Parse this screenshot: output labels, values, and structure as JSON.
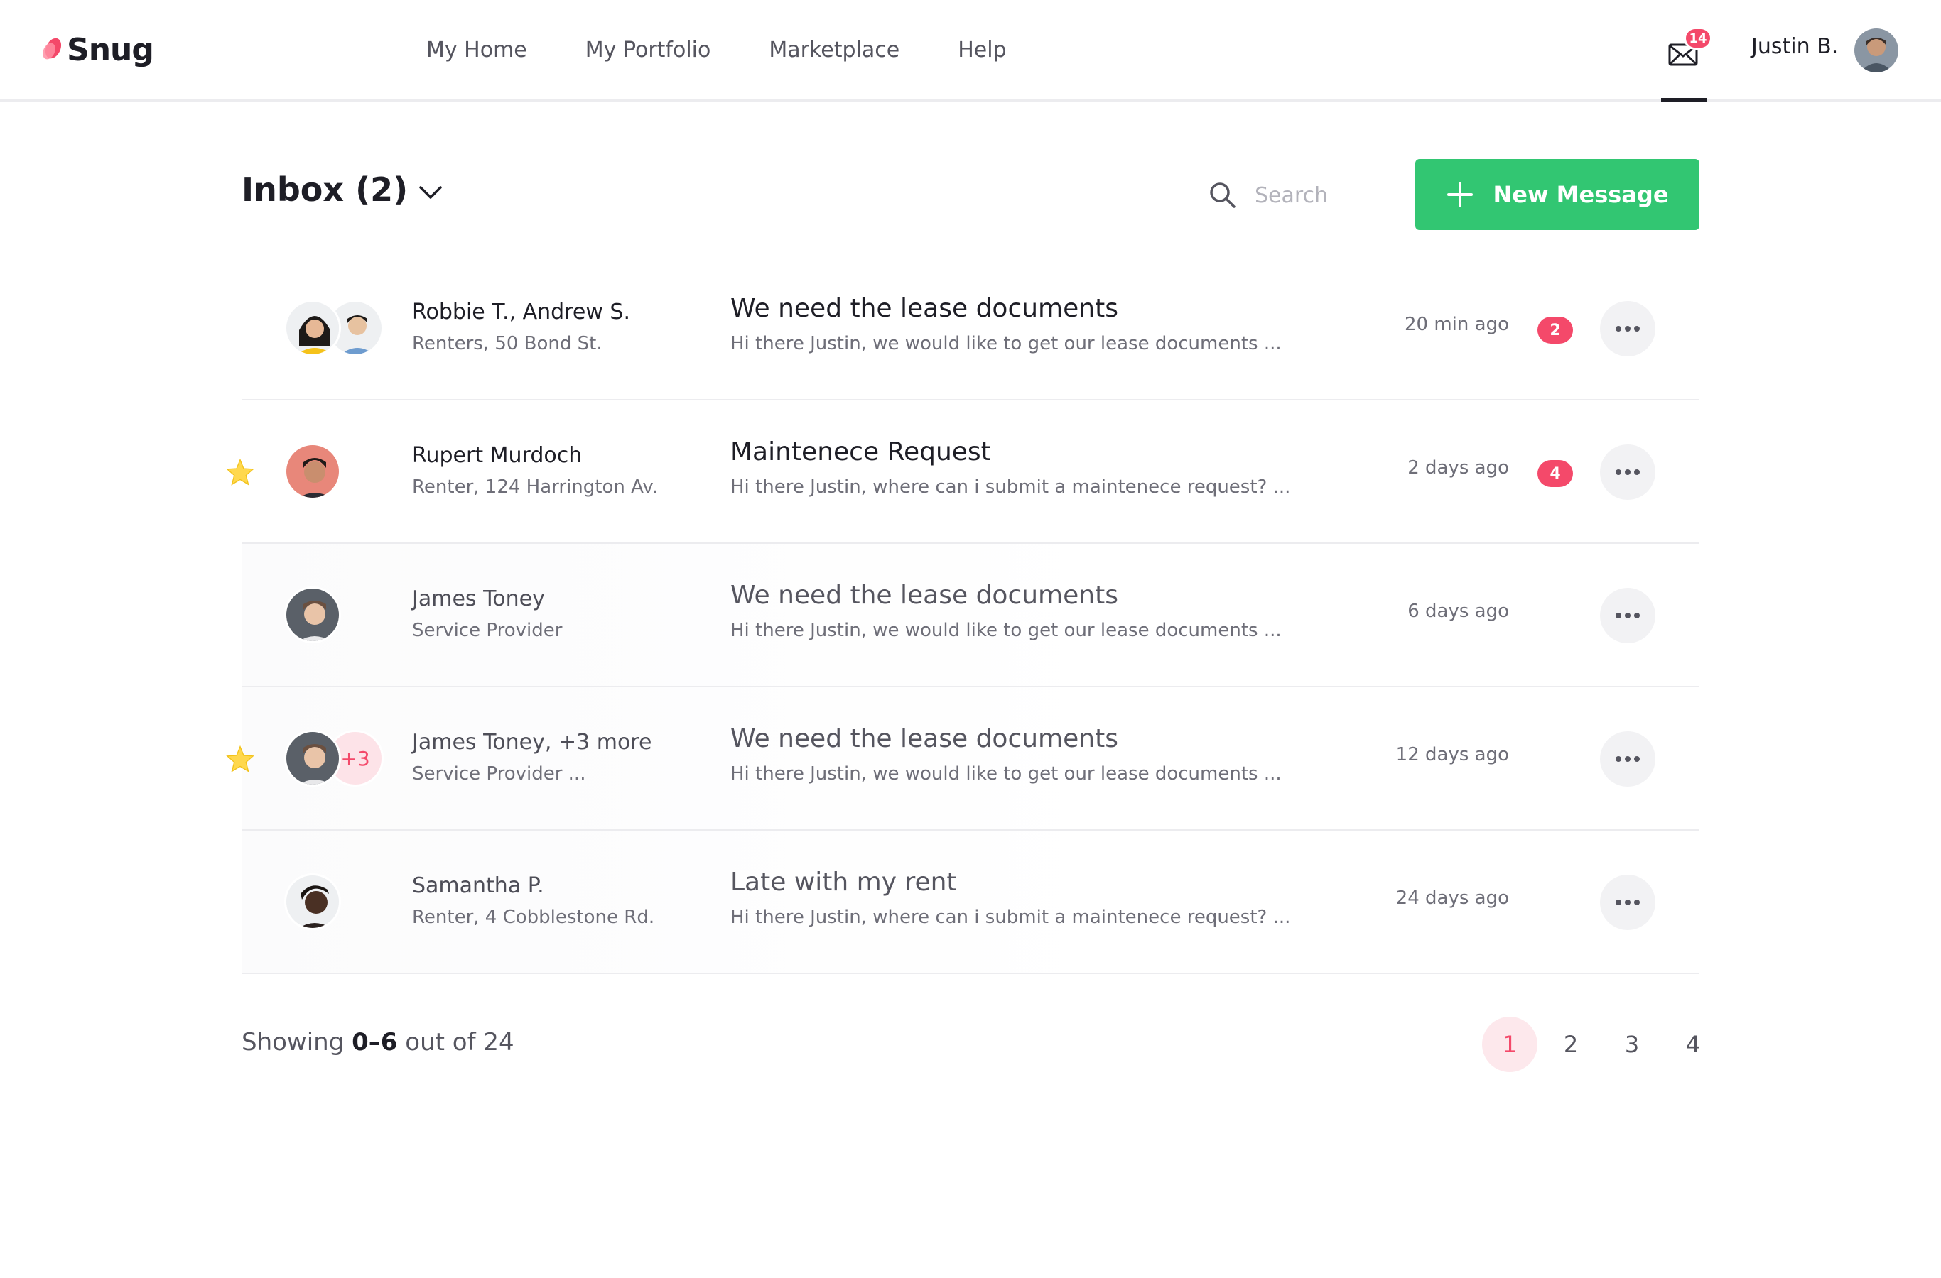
{
  "brand": {
    "name": "Snug",
    "accent": "#f4496a",
    "primary": "#32c672"
  },
  "nav": {
    "items": [
      "My Home",
      "My Portfolio",
      "Marketplace",
      "Help"
    ]
  },
  "header": {
    "mail_badge": "14",
    "user_name": "Justin B."
  },
  "toolbar": {
    "inbox_title": "Inbox (2)",
    "search_placeholder": "Search",
    "new_message_label": "New Message"
  },
  "messages": [
    {
      "sender": "Robbie T., Andrew S.",
      "sub": "Renters, 50 Bond St.",
      "subject": "We need the lease documents",
      "preview": "Hi there Justin, we would like to get our lease documents ...",
      "time": "20 min ago",
      "unread": "2",
      "starred": false
    },
    {
      "sender": "Rupert Murdoch",
      "sub": "Renter, 124 Harrington Av.",
      "subject": "Maintenece Request",
      "preview": "Hi there Justin, where can i submit a maintenece request? ...",
      "time": "2 days ago",
      "unread": "4",
      "starred": true
    },
    {
      "sender": "James Toney",
      "sub": "Service Provider",
      "subject": "We need the lease documents",
      "preview": "Hi there Justin, we would like to get our lease documents ...",
      "time": "6 days ago",
      "unread": "",
      "starred": false
    },
    {
      "sender": "James Toney, +3 more",
      "sub": "Service Provider ...",
      "subject": "We need the lease documents",
      "preview": "Hi there Justin, we would like to get our lease documents ...",
      "time": "12 days ago",
      "unread": "",
      "starred": true,
      "extra_avatar": "+3"
    },
    {
      "sender": "Samantha P.",
      "sub": "Renter, 4 Cobblestone Rd.",
      "subject": "Late with my rent",
      "preview": "Hi there Justin, where can i submit a maintenece request? ...",
      "time": "24 days ago",
      "unread": "",
      "starred": false
    }
  ],
  "footer": {
    "showing_prefix": "Showing",
    "showing_range": "0–6",
    "showing_suffix": "out of 24",
    "pages": [
      "1",
      "2",
      "3",
      "4"
    ],
    "active_page": "1"
  }
}
